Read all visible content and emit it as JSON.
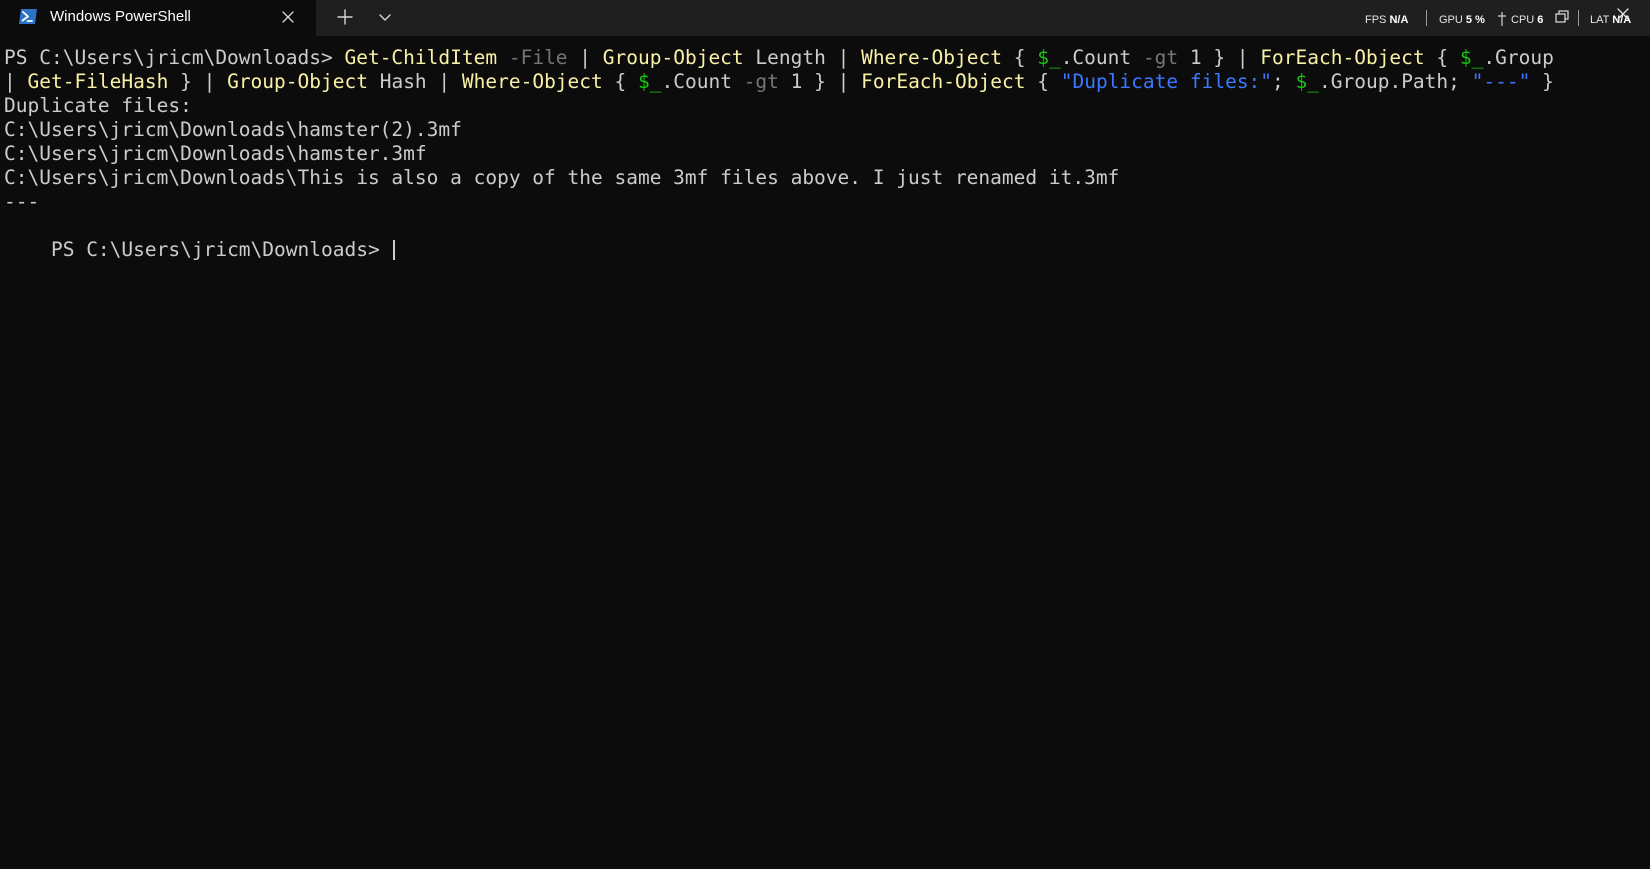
{
  "tab": {
    "title": "Windows PowerShell",
    "icon": "powershell-icon"
  },
  "toolbar": {
    "new_tab_icon": "plus-icon",
    "dropdown_icon": "chevron-down-icon",
    "close_icon": "close-icon"
  },
  "perf": {
    "fps_label": "FPS",
    "fps_value": "N/A",
    "gpu_label": "GPU",
    "gpu_value": "5 %",
    "cpu_label": "CPU",
    "cpu_value": "6",
    "lat_label": "LAT",
    "lat_value": "N/A"
  },
  "terminal": {
    "prompt": "PS C:\\Users\\jricm\\Downloads> ",
    "line1": [
      {
        "t": "PS C:\\Users\\jricm\\Downloads> ",
        "c": "plain"
      },
      {
        "t": "Get-ChildItem",
        "c": "cmd"
      },
      {
        "t": " ",
        "c": "plain"
      },
      {
        "t": "-File",
        "c": "param"
      },
      {
        "t": " | ",
        "c": "plain"
      },
      {
        "t": "Group-Object",
        "c": "cmd"
      },
      {
        "t": " Length | ",
        "c": "plain"
      },
      {
        "t": "Where-Object",
        "c": "cmd"
      },
      {
        "t": " { ",
        "c": "plain"
      },
      {
        "t": "$_",
        "c": "var"
      },
      {
        "t": ".Count ",
        "c": "plain"
      },
      {
        "t": "-gt",
        "c": "param"
      },
      {
        "t": " 1 } | ",
        "c": "plain"
      },
      {
        "t": "ForEach-Object",
        "c": "cmd"
      },
      {
        "t": " { ",
        "c": "plain"
      },
      {
        "t": "$_",
        "c": "var"
      },
      {
        "t": ".Group",
        "c": "plain"
      }
    ],
    "line2": [
      {
        "t": "| ",
        "c": "plain"
      },
      {
        "t": "Get-FileHash",
        "c": "cmd"
      },
      {
        "t": " } | ",
        "c": "plain"
      },
      {
        "t": "Group-Object",
        "c": "cmd"
      },
      {
        "t": " Hash | ",
        "c": "plain"
      },
      {
        "t": "Where-Object",
        "c": "cmd"
      },
      {
        "t": " { ",
        "c": "plain"
      },
      {
        "t": "$_",
        "c": "var"
      },
      {
        "t": ".Count ",
        "c": "plain"
      },
      {
        "t": "-gt",
        "c": "param"
      },
      {
        "t": " 1 } | ",
        "c": "plain"
      },
      {
        "t": "ForEach-Object",
        "c": "cmd"
      },
      {
        "t": " { ",
        "c": "plain"
      },
      {
        "t": "\"Duplicate files:\"",
        "c": "str"
      },
      {
        "t": "; ",
        "c": "plain"
      },
      {
        "t": "$_",
        "c": "var"
      },
      {
        "t": ".Group.Path; ",
        "c": "plain"
      },
      {
        "t": "\"---\"",
        "c": "str"
      },
      {
        "t": " }",
        "c": "plain"
      }
    ],
    "output": [
      "Duplicate files:",
      "C:\\Users\\jricm\\Downloads\\hamster(2).3mf",
      "C:\\Users\\jricm\\Downloads\\hamster.3mf",
      "C:\\Users\\jricm\\Downloads\\This is also a copy of the same 3mf files above. I just renamed it.3mf",
      "---"
    ]
  },
  "colors": {
    "background": "#0c0c0c",
    "titlebar": "#1f1f1f",
    "command": "#f9f1a5",
    "parameter": "#767676",
    "variable": "#16c60c",
    "string": "#3b78ff",
    "text": "#cccccc"
  }
}
